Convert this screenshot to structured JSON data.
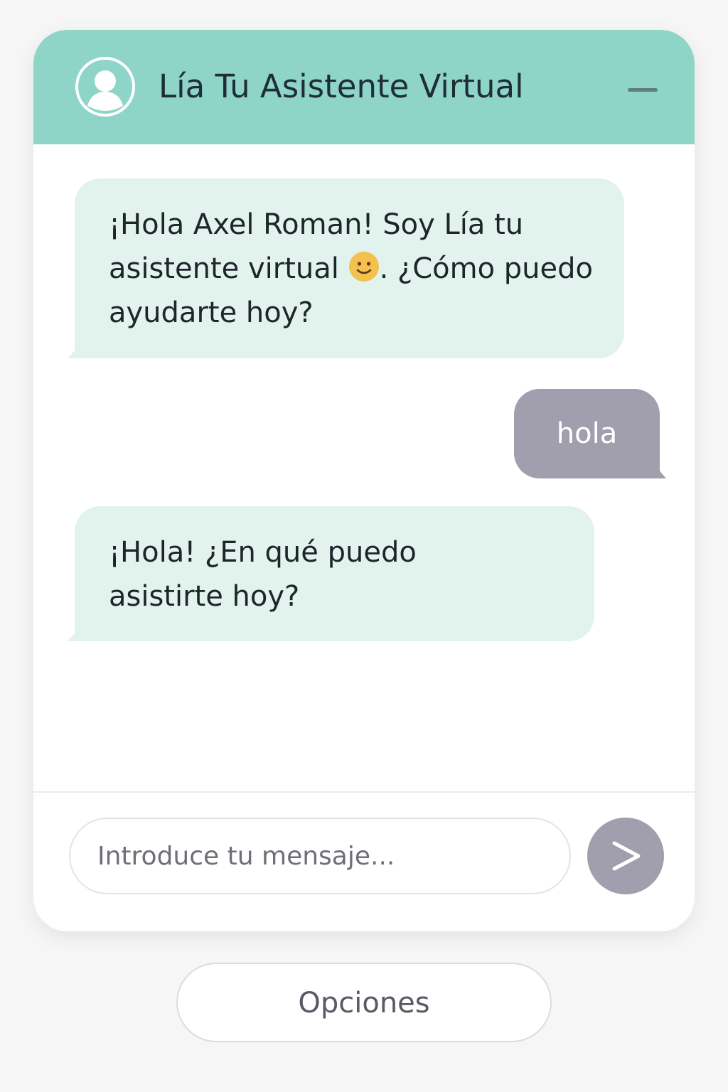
{
  "header": {
    "title": "Lía Tu Asistente Virtual",
    "avatar_icon": "user-avatar-icon",
    "minimize_icon": "minimize-icon",
    "background": "#8ed5c8"
  },
  "messages": [
    {
      "sender": "bot",
      "text_before_emoji": "¡Hola Axel Roman! Soy Lía tu asistente virtual ",
      "emoji": "slightly-smiling-face",
      "text_after_emoji": ". ¿Cómo puedo ayudarte hoy?"
    },
    {
      "sender": "user",
      "text": "hola"
    },
    {
      "sender": "bot",
      "text": "¡Hola! ¿En qué puedo asistirte hoy?"
    }
  ],
  "composer": {
    "placeholder": "Introduce tu mensaje...",
    "value": "",
    "send_icon": "send-arrow-icon"
  },
  "options_button": {
    "label": "Opciones"
  },
  "colors": {
    "bot_bubble": "#e2f2ec",
    "user_bubble": "#a19ead",
    "send_button": "#a19ead",
    "page_background": "#f6f6f6"
  }
}
